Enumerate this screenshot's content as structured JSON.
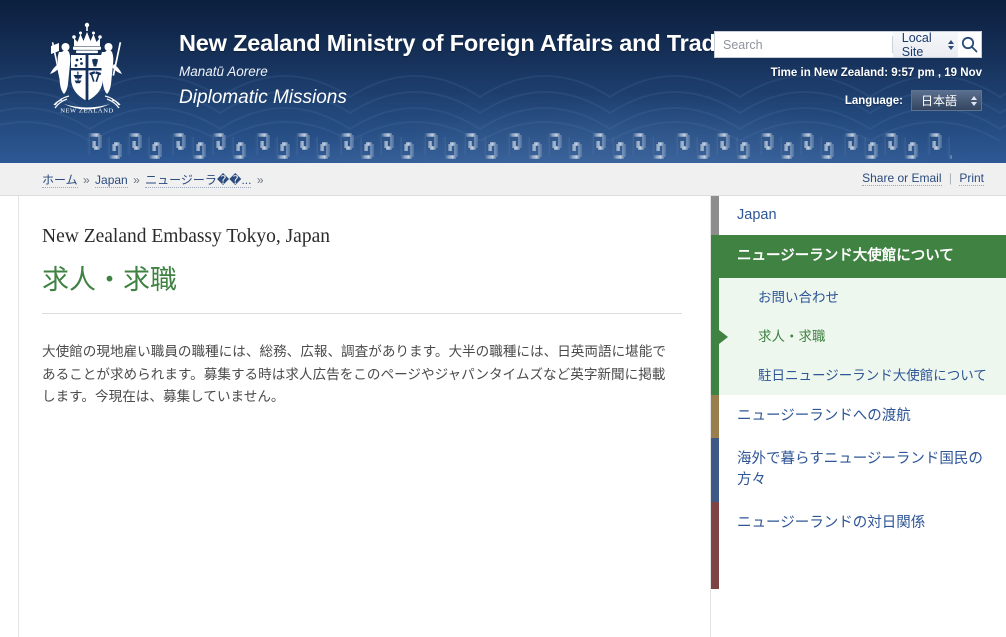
{
  "header": {
    "logo_alt": "New Zealand Coat of Arms",
    "title": "New Zealand Ministry of Foreign Affairs and Trade",
    "maori_title": "Manatū Aorere",
    "subtitle": "Diplomatic Missions",
    "search": {
      "placeholder": "Search",
      "value": "",
      "scope": "Local Site",
      "button_label": "search-icon"
    },
    "time_label": "Time in New Zealand: 9:57 pm , 19 Nov",
    "language_label": "Language:",
    "language_value": "日本語"
  },
  "breadcrumb": {
    "items": [
      {
        "label": "ホーム",
        "link": true
      },
      {
        "label": "Japan",
        "link": true
      },
      {
        "label": "ニュージーラ��...",
        "link": true
      }
    ],
    "separator": "»",
    "trailing_separator": "»",
    "share_label": "Share or Email",
    "divider": "|",
    "print_label": "Print"
  },
  "main": {
    "embassy_title": "New Zealand Embassy Tokyo, Japan",
    "page_heading": "求人・求職",
    "body": "大使館の現地雇い職員の職種には、総務、広報、調査があります。大半の職種には、日英両語に堪能であることが求められます。募集する時は求人広告をこのページやジャパンタイムズなど英字新聞に掲載します。今現在は、募集していません。"
  },
  "sidebar": {
    "items": [
      {
        "label": "Japan",
        "accent": "#8d8d8d",
        "state": "normal"
      },
      {
        "label": "ニュージーランド大使館について",
        "accent": "#3f8242",
        "state": "active"
      },
      {
        "label": "ニュージーランドへの渡航",
        "accent": "#9a7f4e",
        "state": "normal"
      },
      {
        "label": "海外で暮らすニュージーランド国民の方々",
        "accent": "#3c5a85",
        "state": "normal"
      },
      {
        "label": "ニュージーランドの対日関係",
        "accent": "#7d4446",
        "state": "normal"
      }
    ],
    "sub_items": [
      {
        "label": "お問い合わせ",
        "current": false
      },
      {
        "label": "求人・求職",
        "current": true
      },
      {
        "label": "駐日ニュージーランド大使館について",
        "current": false
      }
    ]
  },
  "colors": {
    "header_dark": "#0c1f3d",
    "header_light": "#2d5894",
    "green": "#3f8242",
    "green_pale": "#eef7ee",
    "link_blue": "#2e5596",
    "crumb_bg": "#f0f0f0"
  }
}
